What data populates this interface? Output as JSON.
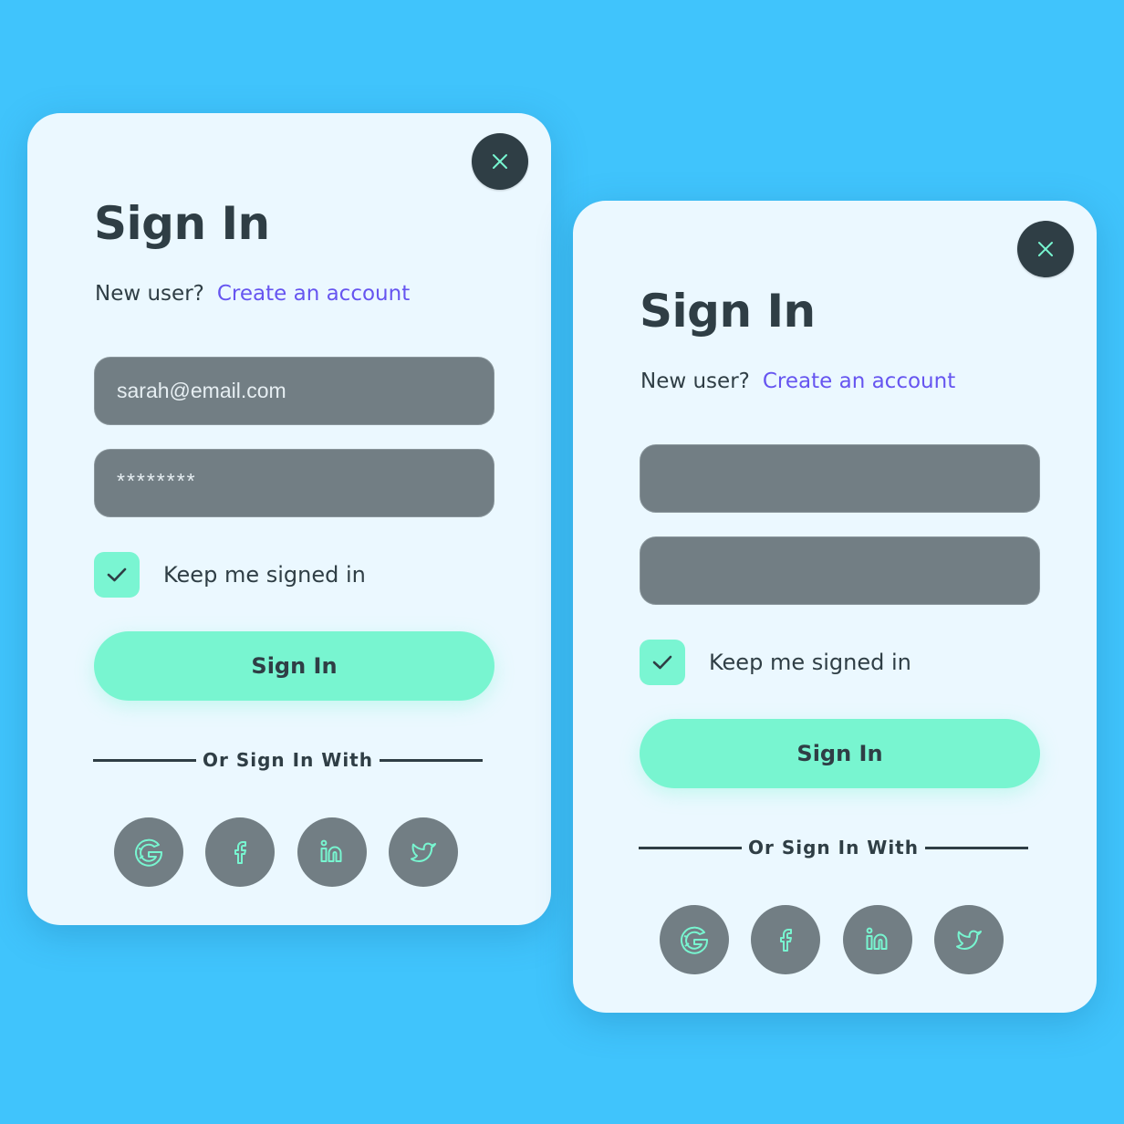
{
  "colors": {
    "background": "#40c4fc",
    "card": "#ebf8ff",
    "accent": "#78f5d0",
    "link": "#6655f0",
    "dark": "#2f3e45",
    "input": "#727e84"
  },
  "cards": [
    {
      "close_icon": "close-icon",
      "title": "Sign In",
      "new_user_text": "New user?",
      "create_account_link": "Create an account",
      "email_value": "sarah@email.com",
      "password_value": "********",
      "remember_checked": true,
      "remember_label": "Keep me signed in",
      "signin_button": "Sign In",
      "divider_text": "Or Sign In With",
      "socials": [
        {
          "name": "Google",
          "icon": "google-icon"
        },
        {
          "name": "Facebook",
          "icon": "facebook-icon"
        },
        {
          "name": "LinkedIn",
          "icon": "linkedin-icon"
        },
        {
          "name": "Twitter",
          "icon": "twitter-icon"
        }
      ]
    },
    {
      "close_icon": "close-icon",
      "title": "Sign In",
      "new_user_text": "New user?",
      "create_account_link": "Create an account",
      "email_value": "",
      "password_value": "",
      "remember_checked": true,
      "remember_label": "Keep me signed in",
      "signin_button": "Sign In",
      "divider_text": "Or Sign In With",
      "socials": [
        {
          "name": "Google",
          "icon": "google-icon"
        },
        {
          "name": "Facebook",
          "icon": "facebook-icon"
        },
        {
          "name": "LinkedIn",
          "icon": "linkedin-icon"
        },
        {
          "name": "Twitter",
          "icon": "twitter-icon"
        }
      ]
    }
  ]
}
